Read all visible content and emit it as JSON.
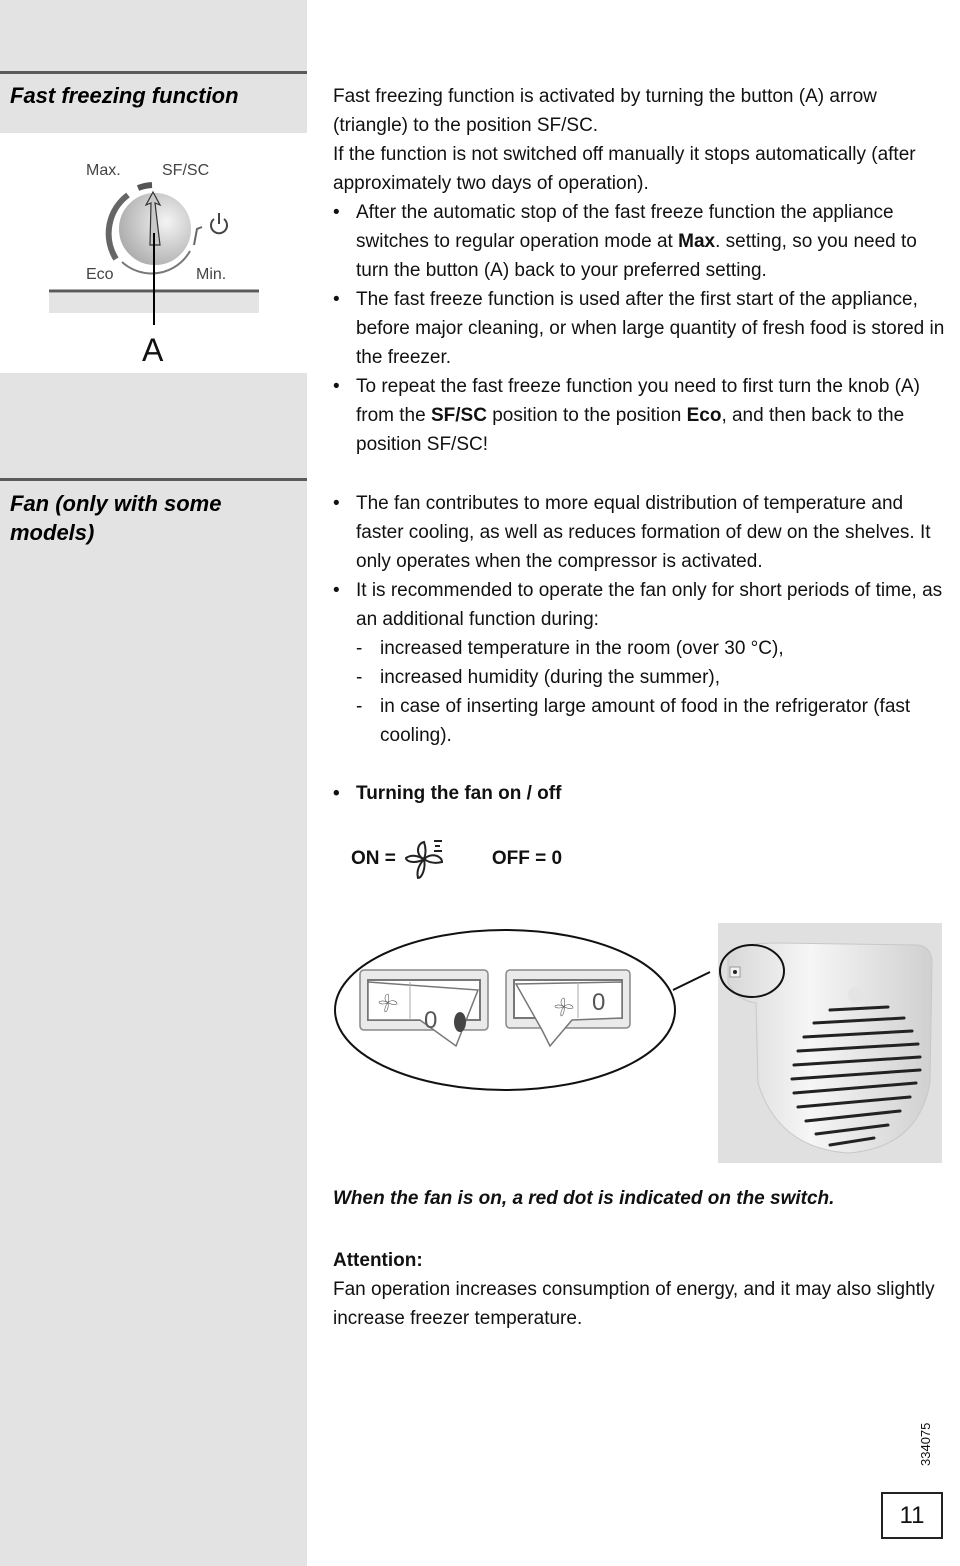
{
  "sidebar": {
    "sections": [
      {
        "title": "Fast freezing function"
      },
      {
        "title": "Fan (only with some models)"
      }
    ],
    "knob": {
      "labels": {
        "max": "Max.",
        "sfsc": "SF/SC",
        "eco": "Eco",
        "min": "Min."
      },
      "callout": "A"
    }
  },
  "fast_freezing": {
    "intro": [
      "Fast freezing function is activated by turning the button (A) arrow (triangle) to the position SF/SC.",
      "If the function is not switched off manually it stops automatically (after approximately two days of operation)."
    ],
    "bullets": [
      {
        "a": "After the automatic stop of the fast freeze function the appliance switches to regular operation mode at ",
        "b": "Max",
        "c": ". setting, so you need to turn the button (A) back to your preferred setting."
      },
      {
        "a": "The fast freeze function is used after the first start of the appliance, before major cleaning, or when large quantity of fresh food is stored in the freezer."
      },
      {
        "a": "To repeat the fast freeze function you need to first turn the knob (A) from the ",
        "b": "SF/SC",
        "c": " position to the position ",
        "d": "Eco",
        "e": ", and then back to the position SF/SC!"
      }
    ],
    "bullet_char": "•"
  },
  "fan": {
    "bullets": [
      "The fan contributes to more equal distribution of temperature and faster cooling, as well as reduces formation of dew on the shelves. It only operates when the compressor is activated.",
      "It is recommended to operate the fan only for short periods of time, as an additional function during:"
    ],
    "dash_items": [
      "increased temperature in the room (over 30 °C),",
      "increased humidity (during the summer),",
      "in case of inserting large amount of food in the refrigerator (fast cooling)."
    ],
    "dash_char": "-",
    "turning_heading": "Turning the fan on / off",
    "on_label": "ON =",
    "off_label": "OFF = 0",
    "switch_zero": "0",
    "caption": "When the fan is on, a red dot is indicated on the switch.",
    "attention_title": "Attention:",
    "attention_text": "Fan operation increases consumption of energy, and it may also slightly increase freezer temperature."
  },
  "footer": {
    "doc_code": "334075",
    "page_number": "11"
  }
}
